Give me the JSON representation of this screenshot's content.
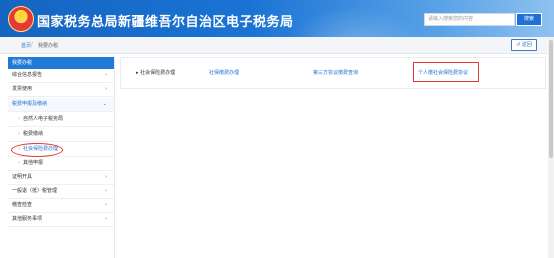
{
  "header": {
    "title": "国家税务总局新疆维吾尔自治区电子税务局",
    "search_placeholder": "请输入搜索您的内容",
    "search_button": "搜索"
  },
  "breadcrumb": {
    "home": "首页",
    "separator": "/",
    "current": "我要办税"
  },
  "back_button": "返回",
  "sidebar": {
    "header": "我要办税",
    "items": [
      {
        "label": "综合信息报告",
        "arrow": "›"
      },
      {
        "label": "发票使用",
        "arrow": "›"
      },
      {
        "label": "税费申报及缴纳",
        "arrow": "⌄"
      },
      {
        "label": "自然人电子税务局"
      },
      {
        "label": "税费缴纳"
      },
      {
        "label": "社会保险费办理"
      },
      {
        "label": "其他申报"
      },
      {
        "label": "证明开具",
        "arrow": "›"
      },
      {
        "label": "一般退（抵）税管理",
        "arrow": "›"
      },
      {
        "label": "稽查检查",
        "arrow": "›"
      },
      {
        "label": "其他服务事项",
        "arrow": "›"
      }
    ]
  },
  "main": {
    "section_title": "▸ 社会保险费办理",
    "links": [
      "社保缴费办理",
      "第三方协议缴费查询",
      "个人缴社会保险费协议"
    ]
  },
  "colors": {
    "brand_blue": "#1f7ad8",
    "highlight_red": "#e53935"
  }
}
